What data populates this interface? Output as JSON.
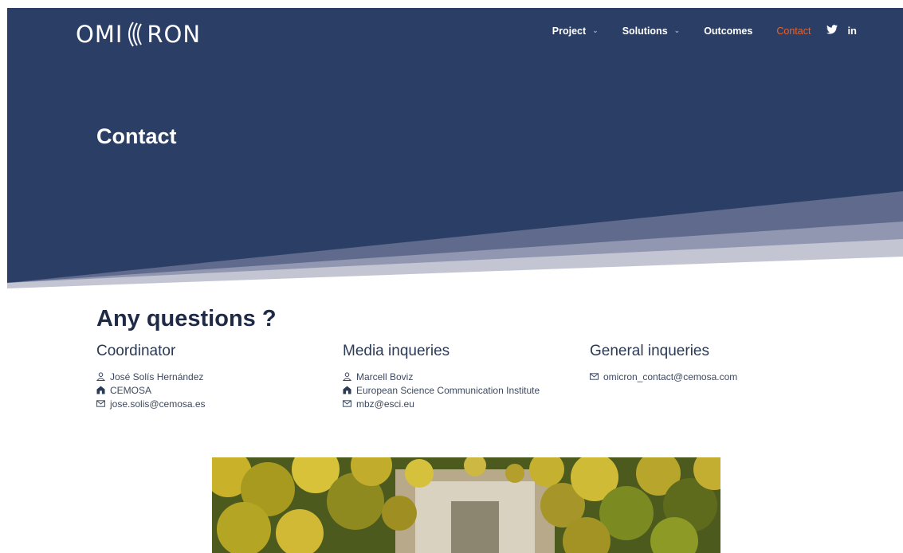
{
  "brand": {
    "logo_left": "OMI",
    "logo_right": "RON"
  },
  "nav": {
    "items": [
      {
        "label": "Project",
        "has_dropdown": true
      },
      {
        "label": "Solutions",
        "has_dropdown": true
      },
      {
        "label": "Outcomes",
        "has_dropdown": false
      },
      {
        "label": "Contact",
        "has_dropdown": false,
        "active": true
      }
    ],
    "social": [
      {
        "icon": "twitter-icon"
      },
      {
        "icon": "linkedin-icon",
        "glyph": "in"
      }
    ]
  },
  "hero": {
    "title": "Contact"
  },
  "contact": {
    "heading": "Any questions ?",
    "columns": [
      {
        "title": "Coordinator",
        "person": "José Solís Hernández",
        "org": "CEMOSA",
        "email": "jose.solis@cemosa.es"
      },
      {
        "title": "Media inqueries",
        "person": "Marcell Boviz",
        "org": "European Science Communication Institute",
        "email": "mbz@esci.eu"
      },
      {
        "title": "General inqueries",
        "email": "omicron_contact@cemosa.com"
      }
    ]
  },
  "colors": {
    "hero_navy": "#2b3f66",
    "band_mid": "#77809c",
    "band_light": "#c3c5d3",
    "accent": "#e8612c"
  }
}
